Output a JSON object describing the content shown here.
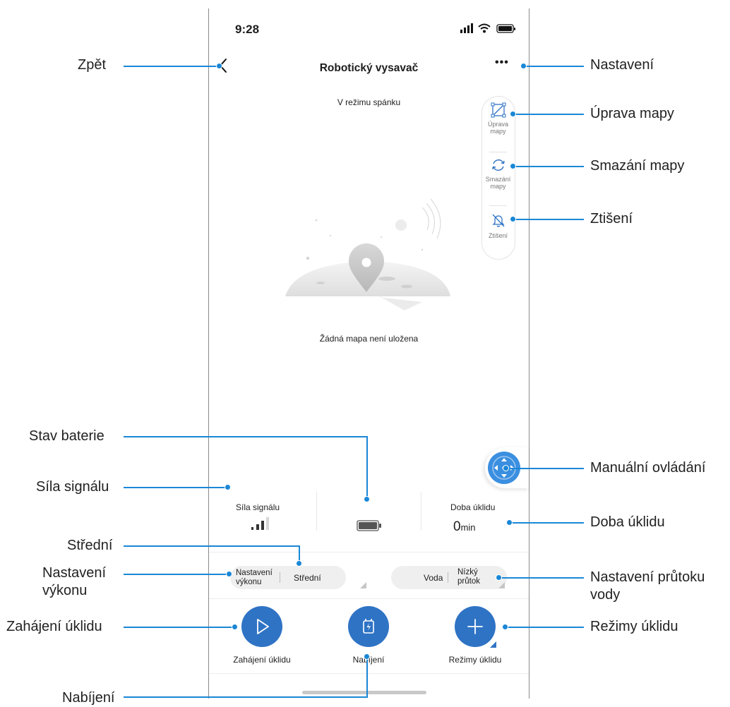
{
  "status_bar": {
    "time": "9:28"
  },
  "header": {
    "title": "Robotický vysavač",
    "more_glyph": "•••",
    "back_glyph": "‹"
  },
  "map": {
    "state": "V režimu spánku",
    "empty_message": "Žádná mapa není uložena"
  },
  "side_tools": [
    {
      "label_line1": "Úprava",
      "label_line2": "mapy"
    },
    {
      "label_line1": "Smazání",
      "label_line2": "mapy"
    },
    {
      "label_line1": "Ztišení",
      "label_line2": ""
    }
  ],
  "stats": {
    "signal_label": "Síla signálu",
    "cleaning_time_label": "Doba úklidu",
    "cleaning_time_value": "0",
    "cleaning_time_unit": "min"
  },
  "settings": {
    "power_label_line1": "Nastavení",
    "power_label_line2": "výkonu",
    "power_value": "Střední",
    "water_label": "Voda",
    "water_value_line1": "Nízký",
    "water_value_line2": "průtok"
  },
  "actions": {
    "start_label": "Zahájení úklidu",
    "charge_label": "Nabíjení",
    "modes_label": "Režimy úklidu"
  },
  "callouts": {
    "back": "Zpět",
    "settings": "Nastavení",
    "edit_map": "Úprava mapy",
    "delete_map": "Smazání mapy",
    "mute": "Ztišení",
    "battery_status": "Stav baterie",
    "manual_control": "Manuální ovládání",
    "signal_strength": "Síla signálu",
    "cleaning_time": "Doba úklidu",
    "medium": "Střední",
    "power_setting_line1": "Nastavení",
    "power_setting_line2": "výkonu",
    "water_flow_line1": "Nastavení průtoku",
    "water_flow_line2": "vody",
    "start_cleaning": "Zahájení úklidu",
    "cleaning_modes": "Režimy úklidu",
    "charging": "Nabíjení"
  },
  "colors": {
    "accent": "#1a87d6",
    "button_blue": "#2f73c5",
    "pill_gray": "#efefef"
  }
}
